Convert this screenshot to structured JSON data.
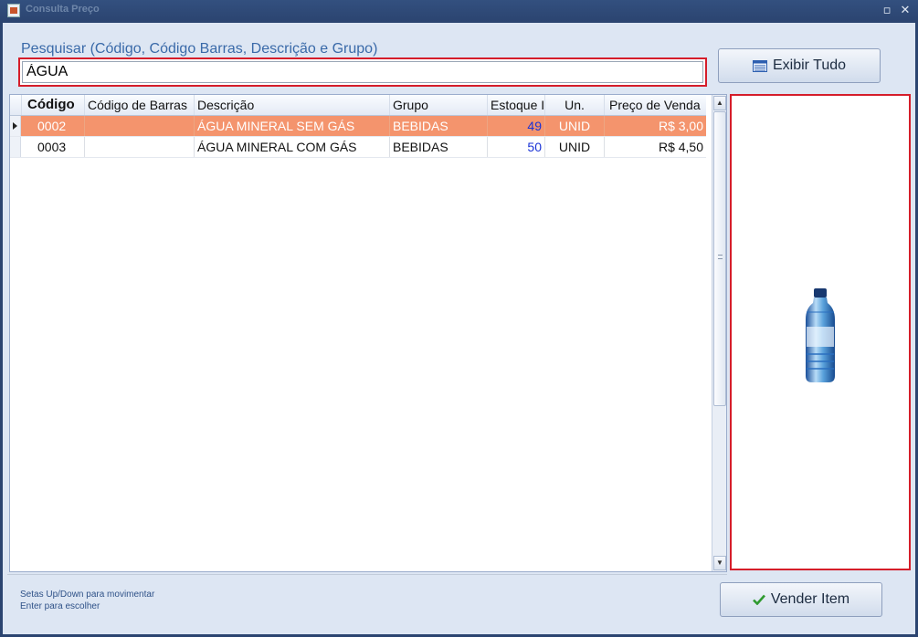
{
  "window": {
    "title": "Consulta Preço"
  },
  "search": {
    "label": "Pesquisar (Código, Código Barras, Descrição e Grupo)",
    "value": "ÁGUA"
  },
  "buttons": {
    "exibir_tudo": "Exibir Tudo",
    "vender_item": "Vender Item"
  },
  "table": {
    "columns": [
      "Código",
      "Código de Barras",
      "Descrição",
      "Grupo",
      "Estoque I",
      "Un.",
      "Preço de Venda"
    ],
    "rows": [
      {
        "codigo": "0002",
        "codigo_barras": "",
        "descricao": "ÁGUA MINERAL SEM GÁS",
        "grupo": "BEBIDAS",
        "estoque": "49",
        "un": "UNID",
        "preco": "R$ 3,00",
        "selected": true
      },
      {
        "codigo": "0003",
        "codigo_barras": "",
        "descricao": "ÁGUA MINERAL COM GÁS",
        "grupo": "BEBIDAS",
        "estoque": "50",
        "un": "UNID",
        "preco": "R$ 4,50",
        "selected": false
      }
    ]
  },
  "hints": {
    "line1": "Setas Up/Down para movimentar",
    "line2": "Enter para escolher"
  },
  "product_image": {
    "icon": "water-bottle-icon"
  },
  "colors": {
    "selected_row": "#f4946d",
    "highlight_border": "#d51d2a",
    "stock_number": "#1a33d6"
  }
}
